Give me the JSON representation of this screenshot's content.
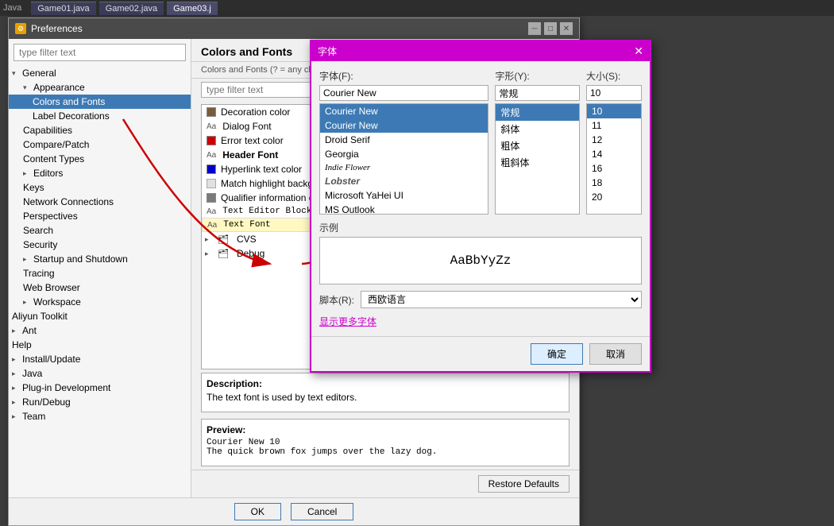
{
  "taskbar": {
    "title": "Java",
    "tabs": [
      {
        "label": "Game01.java",
        "active": false
      },
      {
        "label": "Game02.java",
        "active": false
      },
      {
        "label": "Game03.j",
        "active": true
      }
    ]
  },
  "preferences": {
    "title": "Preferences",
    "filter_placeholder": "type filter text",
    "sidebar": {
      "items": [
        {
          "id": "general",
          "label": "General",
          "level": 0,
          "expandable": true,
          "expanded": true
        },
        {
          "id": "appearance",
          "label": "Appearance",
          "level": 1,
          "expandable": true,
          "expanded": true
        },
        {
          "id": "colors-fonts",
          "label": "Colors and Fonts",
          "level": 2,
          "selected": true
        },
        {
          "id": "label-decorations",
          "label": "Label Decorations",
          "level": 2
        },
        {
          "id": "capabilities",
          "label": "Capabilities",
          "level": 1
        },
        {
          "id": "compare-patch",
          "label": "Compare/Patch",
          "level": 1
        },
        {
          "id": "content-types",
          "label": "Content Types",
          "level": 1
        },
        {
          "id": "editors",
          "label": "Editors",
          "level": 1,
          "expandable": true
        },
        {
          "id": "keys",
          "label": "Keys",
          "level": 1
        },
        {
          "id": "network-connections",
          "label": "Network Connections",
          "level": 1
        },
        {
          "id": "perspectives",
          "label": "Perspectives",
          "level": 1
        },
        {
          "id": "search",
          "label": "Search",
          "level": 1
        },
        {
          "id": "security",
          "label": "Security",
          "level": 1
        },
        {
          "id": "startup-shutdown",
          "label": "Startup and Shutdown",
          "level": 1,
          "expandable": true
        },
        {
          "id": "tracing",
          "label": "Tracing",
          "level": 1
        },
        {
          "id": "web-browser",
          "label": "Web Browser",
          "level": 1
        },
        {
          "id": "workspace",
          "label": "Workspace",
          "level": 1,
          "expandable": true
        },
        {
          "id": "aliyun-toolkit",
          "label": "Aliyun Toolkit",
          "level": 0
        },
        {
          "id": "ant",
          "label": "Ant",
          "level": 0,
          "expandable": true
        },
        {
          "id": "help",
          "label": "Help",
          "level": 0
        },
        {
          "id": "install-update",
          "label": "Install/Update",
          "level": 0,
          "expandable": true
        },
        {
          "id": "java",
          "label": "Java",
          "level": 0,
          "expandable": true
        },
        {
          "id": "plugin-dev",
          "label": "Plug-in Development",
          "level": 0,
          "expandable": true
        },
        {
          "id": "run-debug",
          "label": "Run/Debug",
          "level": 0,
          "expandable": true
        },
        {
          "id": "team",
          "label": "Team",
          "level": 0,
          "expandable": true
        }
      ]
    },
    "content": {
      "title": "Colors and Fonts",
      "subtitle": "Colors and Fonts (? = any character, * = any string):",
      "filter_placeholder": "type filter text",
      "items": [
        {
          "label": "Decoration color",
          "type": "color",
          "color": "#7a5c3a",
          "bold": false
        },
        {
          "label": "Dialog Font",
          "type": "font",
          "bold": false
        },
        {
          "label": "Error text color",
          "type": "color",
          "color": "#cc0000",
          "bold": false
        },
        {
          "label": "Header Font",
          "type": "font",
          "bold": true
        },
        {
          "label": "Hyperlink text color",
          "type": "color",
          "color": "#0000cc",
          "bold": false
        },
        {
          "label": "Match highlight background color",
          "type": "color",
          "color": "#f0f0f0",
          "bold": false
        },
        {
          "label": "Qualifier information color",
          "type": "color",
          "color": "#7a7a7a",
          "bold": false
        },
        {
          "label": "Text Editor Block Selection Font",
          "type": "font",
          "mono": true,
          "bold": false
        },
        {
          "label": "Text Font",
          "type": "font",
          "mono": true,
          "bold": false,
          "selected": true
        }
      ],
      "groups": [
        {
          "label": "CVS",
          "expandable": true
        },
        {
          "label": "Debug",
          "expandable": true
        }
      ],
      "description": {
        "label": "Description:",
        "text": "The text font is used by text editors."
      },
      "preview": {
        "label": "Preview:",
        "text": "Courier New 10\nThe quick brown fox jumps over the lazy dog."
      },
      "restore_button": "Restore Defaults"
    },
    "footer": {
      "ok_label": "OK",
      "cancel_label": "Cancel"
    }
  },
  "font_dialog": {
    "title": "字体",
    "close_btn": "✕",
    "font_label": "字体(F):",
    "style_label": "字形(Y):",
    "size_label": "大小(S):",
    "font_input": "Courier New",
    "style_input": "常规",
    "size_input": "10",
    "fonts": [
      {
        "name": "Courier New",
        "selected": true,
        "highlighted": true
      },
      {
        "name": "Droid Serif"
      },
      {
        "name": "Georgia"
      },
      {
        "name": "Indie Flower",
        "special": "italic"
      },
      {
        "name": "Lobster",
        "special": "lobster"
      },
      {
        "name": "Microsoft YaHei UI",
        "special": "chinese"
      },
      {
        "name": "MS Outlook"
      }
    ],
    "styles": [
      {
        "name": "常规",
        "selected": true,
        "highlighted": true
      },
      {
        "name": "斜体"
      },
      {
        "name": "粗体"
      },
      {
        "name": "粗斜体"
      }
    ],
    "sizes": [
      {
        "value": "10",
        "selected": true,
        "highlighted": true
      },
      {
        "value": "11"
      },
      {
        "value": "12"
      },
      {
        "value": "14"
      },
      {
        "value": "16"
      },
      {
        "value": "18"
      },
      {
        "value": "20"
      }
    ],
    "sample_label": "示例",
    "sample_text": "AaBbYyZz",
    "script_label": "脚本(R):",
    "script_value": "西欧语言",
    "show_more": "显示更多字体",
    "ok_btn": "确定",
    "cancel_btn": "取消"
  }
}
